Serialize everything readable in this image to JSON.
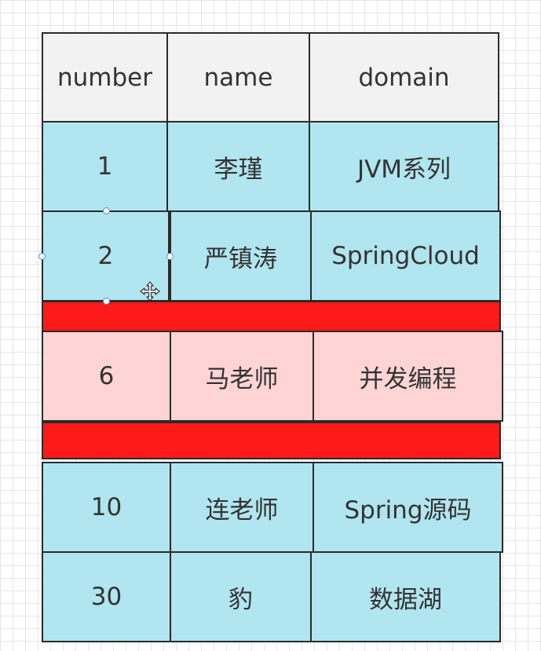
{
  "colors": {
    "header_fill": "#f2f2f2",
    "normal_fill": "#b1e5f0",
    "highlight_fill": "#ffd4d4",
    "separator_fill": "#ff1a1a",
    "selection_handle": "#4a90e2"
  },
  "table": {
    "headers": [
      "number",
      "name",
      "domain"
    ],
    "rows": [
      [
        "1",
        "李瑾",
        "JVM系列"
      ],
      [
        "2",
        "严镇涛",
        "SpringCloud"
      ],
      [
        "6",
        "马老师",
        "并发编程"
      ],
      [
        "10",
        "连老师",
        "Spring源码"
      ],
      [
        "30",
        "豹",
        "数据湖"
      ]
    ]
  },
  "cursor": {
    "icon": "move-cursor-icon"
  }
}
